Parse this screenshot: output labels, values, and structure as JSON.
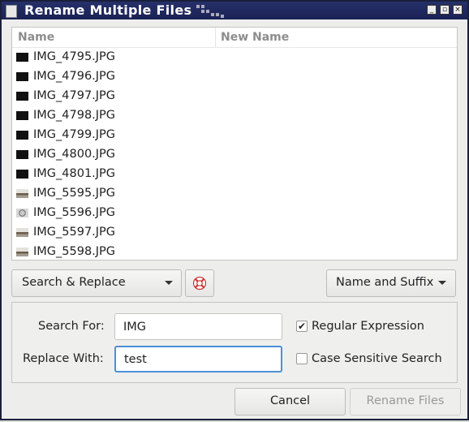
{
  "window": {
    "title": "Rename Multiple Files",
    "controls": {
      "minimize": "_",
      "maximize": "▫",
      "close": "×"
    }
  },
  "file_list": {
    "columns": [
      "Name",
      "New Name"
    ],
    "rows": [
      {
        "name": "IMG_4795.JPG",
        "new_name": "",
        "thumb": "black"
      },
      {
        "name": "IMG_4796.JPG",
        "new_name": "",
        "thumb": "black"
      },
      {
        "name": "IMG_4797.JPG",
        "new_name": "",
        "thumb": "black"
      },
      {
        "name": "IMG_4798.JPG",
        "new_name": "",
        "thumb": "black"
      },
      {
        "name": "IMG_4799.JPG",
        "new_name": "",
        "thumb": "black"
      },
      {
        "name": "IMG_4800.JPG",
        "new_name": "",
        "thumb": "black"
      },
      {
        "name": "IMG_4801.JPG",
        "new_name": "",
        "thumb": "black"
      },
      {
        "name": "IMG_5595.JPG",
        "new_name": "",
        "thumb": "photo"
      },
      {
        "name": "IMG_5596.JPG",
        "new_name": "",
        "thumb": "round"
      },
      {
        "name": "IMG_5597.JPG",
        "new_name": "",
        "thumb": "photo"
      },
      {
        "name": "IMG_5598.JPG",
        "new_name": "",
        "thumb": "photo"
      }
    ]
  },
  "toolbar": {
    "mode_label": "Search & Replace",
    "help_icon": "lifebuoy-icon",
    "format_label": "Name and Suffix"
  },
  "search": {
    "search_label": "Search For:",
    "search_value": "IMG",
    "replace_label": "Replace With:",
    "replace_value": "test",
    "regex_label": "Regular Expression",
    "regex_checked": true,
    "case_label": "Case Sensitive Search",
    "case_checked": false
  },
  "actions": {
    "cancel_label": "Cancel",
    "rename_label": "Rename Files"
  },
  "colors": {
    "titlebar": "#1a2154",
    "focus": "#4a90d9"
  }
}
